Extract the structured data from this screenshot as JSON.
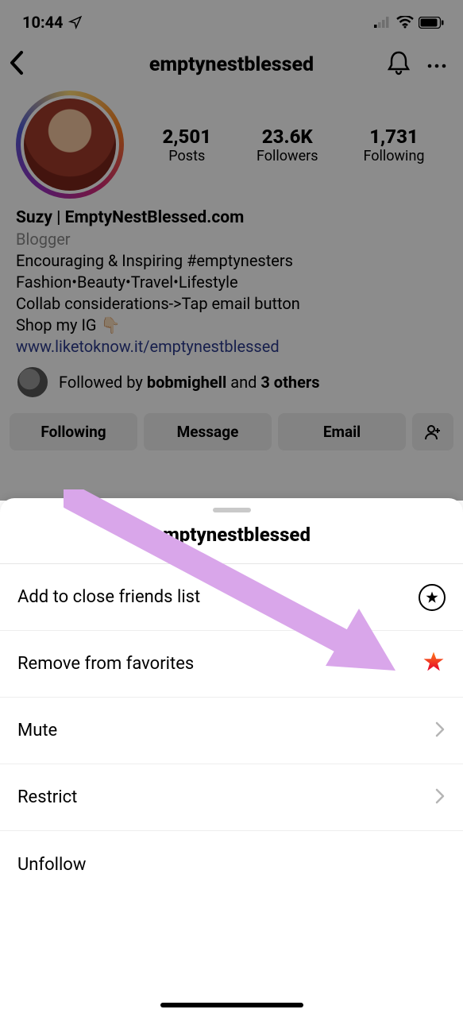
{
  "status_bar": {
    "time": "10:44"
  },
  "nav": {
    "title": "emptynestblessed"
  },
  "stats": {
    "posts": {
      "value": "2,501",
      "label": "Posts"
    },
    "followers": {
      "value": "23.6K",
      "label": "Followers"
    },
    "following": {
      "value": "1,731",
      "label": "Following"
    }
  },
  "bio": {
    "display_name": "Suzy | EmptyNestBlessed.com",
    "category": "Blogger",
    "line1": "Encouraging & Inspiring #emptynesters",
    "line2": "Fashion•Beauty•Travel•Lifestyle",
    "line3": "Collab considerations->Tap email button",
    "line4": "Shop my IG 👇🏻",
    "link": "www.liketoknow.it/emptynestblessed"
  },
  "followed_by": {
    "prefix": "Followed by ",
    "name": "bobmighell",
    "middle": " and ",
    "others": "3 others"
  },
  "buttons": {
    "following": "Following",
    "message": "Message",
    "email": "Email"
  },
  "sheet": {
    "title": "emptynestblessed",
    "items": {
      "close_friends": "Add to close friends list",
      "remove_favorites": "Remove from favorites",
      "mute": "Mute",
      "restrict": "Restrict",
      "unfollow": "Unfollow"
    }
  }
}
